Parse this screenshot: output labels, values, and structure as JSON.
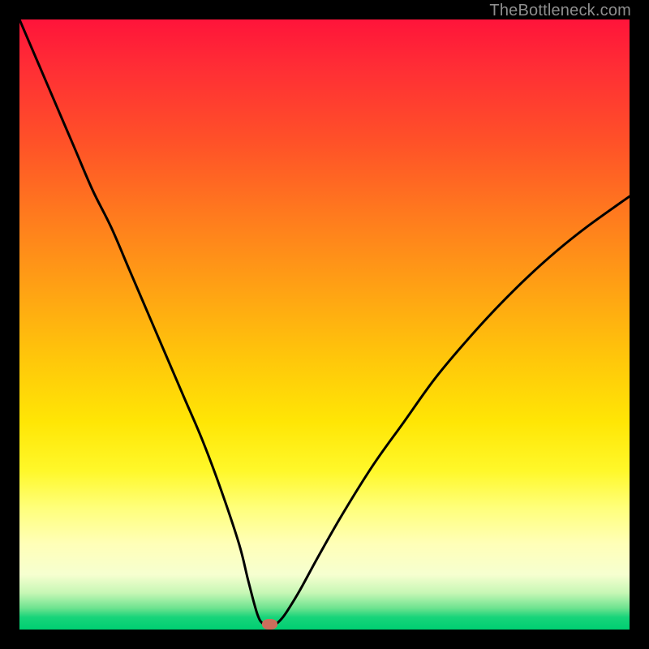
{
  "watermark": "TheBottleneck.com",
  "marker": {
    "x_pct": 41.0,
    "y_pct": 99.1
  },
  "chart_data": {
    "type": "line",
    "title": "",
    "xlabel": "",
    "ylabel": "",
    "xlim": [
      0,
      100
    ],
    "ylim": [
      0,
      100
    ],
    "series": [
      {
        "name": "bottleneck-curve",
        "x": [
          0,
          3,
          6,
          9,
          12,
          15,
          18,
          21,
          24,
          27,
          30,
          33,
          36,
          37.5,
          39,
          40,
          41,
          42,
          43,
          44,
          46,
          49,
          53,
          58,
          63,
          68,
          73,
          78,
          83,
          88,
          93,
          100
        ],
        "y": [
          100,
          93,
          86,
          79,
          72,
          66,
          59,
          52,
          45,
          38,
          31,
          23,
          14,
          8,
          2.5,
          0.9,
          0.9,
          0.9,
          1.8,
          3.2,
          6.5,
          12,
          19,
          27,
          34,
          41,
          47,
          52.5,
          57.5,
          62,
          66,
          71
        ]
      }
    ],
    "annotations": [
      {
        "type": "marker",
        "x": 41,
        "y": 0.9,
        "color": "#cb6e5c"
      }
    ]
  }
}
